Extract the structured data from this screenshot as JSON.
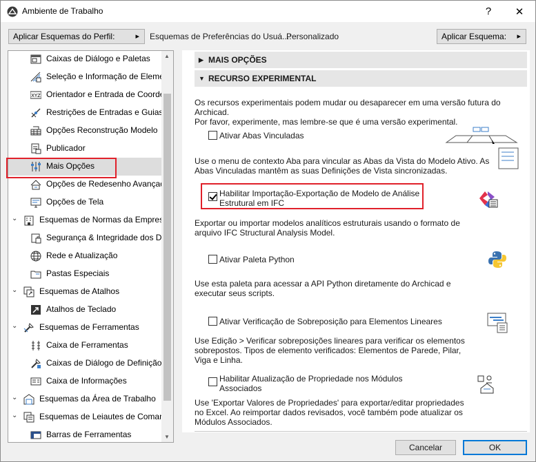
{
  "window": {
    "title": "Ambiente de Trabalho",
    "help_glyph": "?",
    "close_glyph": "✕"
  },
  "toolbar": {
    "perfil_button": "Aplicar Esquemas do Perfil:",
    "scheme_label": "Esquemas de Preferências do Usuá...:",
    "scheme_value": "Personalizado",
    "aplicar_button": "Aplicar Esquema:"
  },
  "tree": {
    "items": [
      {
        "label": "Caixas de Diálogo e Paletas",
        "level": 2,
        "icon": "dialog-icon"
      },
      {
        "label": "Seleção e Informação de Element",
        "level": 2,
        "icon": "selection-icon"
      },
      {
        "label": "Orientador e Entrada de Coorder",
        "level": 2,
        "icon": "xyz-icon"
      },
      {
        "label": "Restrições de Entradas e Guias",
        "level": 2,
        "icon": "constraint-icon"
      },
      {
        "label": "Opções Reconstrução Modelo",
        "level": 2,
        "icon": "rebuild-icon"
      },
      {
        "label": "Publicador",
        "level": 2,
        "icon": "publisher-icon"
      },
      {
        "label": "Mais Opções",
        "level": 2,
        "icon": "sliders-icon",
        "selected": true
      },
      {
        "label": "Opções de Redesenho Avançada",
        "level": 2,
        "icon": "redraw-icon"
      },
      {
        "label": "Opções de Tela",
        "level": 2,
        "icon": "screen-icon"
      },
      {
        "label": "Esquemas de Normas da Empresa",
        "level": 1,
        "icon": "company-icon"
      },
      {
        "label": "Segurança & Integridade dos Da",
        "level": 2,
        "icon": "security-icon"
      },
      {
        "label": "Rede e Atualização",
        "level": 2,
        "icon": "globe-icon"
      },
      {
        "label": "Pastas Especiais",
        "level": 2,
        "icon": "folder-icon"
      },
      {
        "label": "Esquemas de Atalhos",
        "level": 1,
        "icon": "shortcut-scheme-icon"
      },
      {
        "label": "Atalhos de Teclado",
        "level": 2,
        "icon": "keyboard-shortcut-icon"
      },
      {
        "label": "Esquemas de Ferramentas",
        "level": 1,
        "icon": "tool-scheme-icon"
      },
      {
        "label": "Caixa de Ferramentas",
        "level": 2,
        "icon": "toolbox-icon"
      },
      {
        "label": "Caixas de Diálogo de Definição d",
        "level": 2,
        "icon": "tool-settings-icon"
      },
      {
        "label": "Caixa de Informações",
        "level": 2,
        "icon": "info-box-icon"
      },
      {
        "label": "Esquemas da Área de Trabalho",
        "level": 1,
        "icon": "workspace-icon"
      },
      {
        "label": "Esquemas de Leiautes de Comando",
        "level": 1,
        "icon": "command-layout-icon"
      },
      {
        "label": "Barras de Ferramentas",
        "level": 2,
        "icon": "toolbars-icon"
      }
    ]
  },
  "right": {
    "more_options_header": "MAIS OPÇÕES",
    "experimental_header": "RECURSO EXPERIMENTAL",
    "intro_line1": "Os recursos experimentais podem mudar ou desaparecer em uma versão futura do Archicad.",
    "intro_line2": "Por favor, experimente, mas lembre-se que é uma versão experimental.",
    "options": [
      {
        "label_lines": [
          "Ativar Abas Vinculadas"
        ],
        "checked": false,
        "desc_lines": [
          "Use o menu de contexto Aba para vincular as Abas da Vista do Modelo Ativo. As",
          "Abas Vinculadas mantêm as suas Definições de Vista sincronizadas."
        ],
        "icon": "linked-tabs-icon"
      },
      {
        "label_lines": [
          "Habilitar Importação-Exportação de Modelo de Análise",
          "Estrutural em IFC"
        ],
        "checked": true,
        "desc_lines": [
          "Exportar ou importar modelos analíticos estruturais usando o formato de",
          "arquivo IFC Structural Analysis Model."
        ],
        "icon": "ifc-icon"
      },
      {
        "label_lines": [
          "Ativar Paleta Python"
        ],
        "checked": false,
        "desc_lines": [
          "Use esta paleta para acessar a API Python diretamente do Archicad e",
          "executar seus scripts."
        ],
        "icon": "python-icon"
      },
      {
        "label_lines": [
          "Ativar Verificação de Sobreposição para Elementos Lineares"
        ],
        "checked": false,
        "desc_lines": [
          "Use Edição > Verificar sobreposições lineares para verificar os elementos",
          "sobrepostos. Tipos de elemento verificados: Elementos de Parede, Pilar,",
          "Viga e Linha."
        ],
        "icon": "overlap-check-icon"
      },
      {
        "label_lines": [
          "Habilitar Atualização de Propriedade nos Módulos",
          "Associados"
        ],
        "checked": false,
        "desc_lines": [
          "Use 'Exportar Valores de Propriedades' para exportar/editar propriedades",
          "no Excel. Ao reimportar dados revisados, você também pode atualizar os",
          "Módulos Associados."
        ],
        "icon": "property-update-icon"
      }
    ]
  },
  "footer": {
    "cancel": "Cancelar",
    "ok": "OK"
  },
  "colors": {
    "highlight": "#e0202a",
    "selected_row": "#dddddd",
    "section_bg": "#e6e6e6"
  }
}
